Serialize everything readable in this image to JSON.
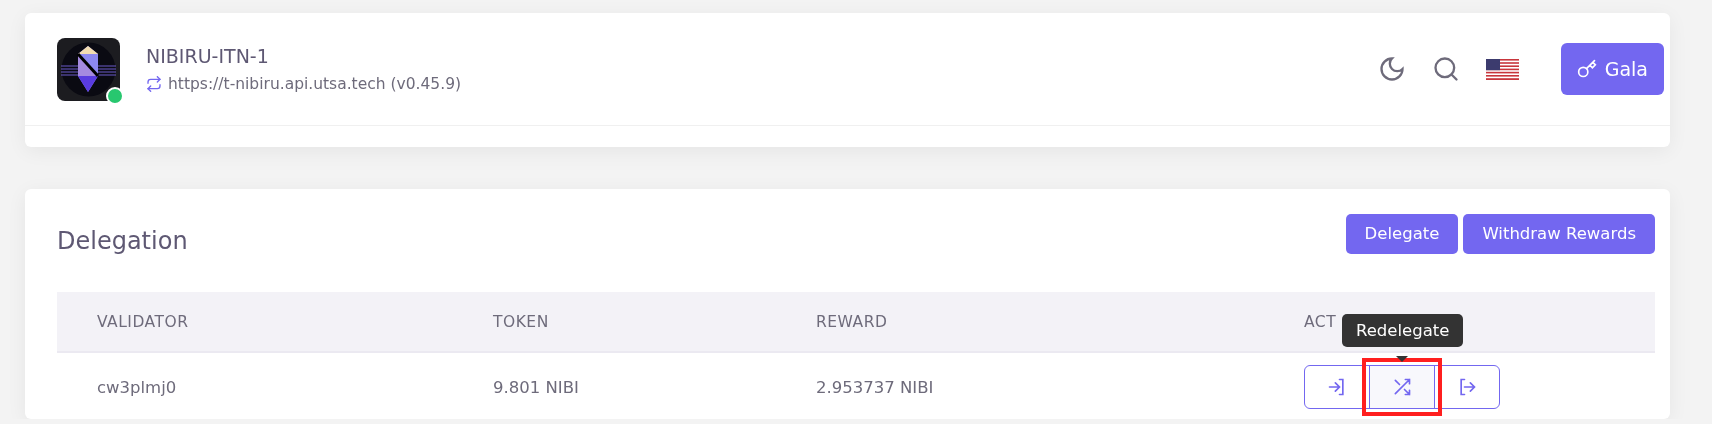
{
  "header": {
    "chain": "NIBIRU-ITN-1",
    "online": true,
    "endpoint": "https://t-nibiru.api.utsa.tech (v0.45.9)",
    "wallet_button": "Gala"
  },
  "delegation": {
    "title": "Delegation",
    "buttons": [
      "Delegate",
      "Withdraw Rewards"
    ],
    "columns": [
      "VALIDATOR",
      "TOKEN",
      "REWARD",
      "ACT"
    ],
    "rows": [
      {
        "validator": "cw3plmj0",
        "token": "9.801 NIBI",
        "reward": "2.953737 NIBI",
        "actions": [
          {
            "kind": "delegate",
            "highlighted": false
          },
          {
            "kind": "redelegate",
            "highlighted": true
          },
          {
            "kind": "unbond",
            "highlighted": false
          }
        ]
      }
    ],
    "tooltip": "Redelegate"
  }
}
